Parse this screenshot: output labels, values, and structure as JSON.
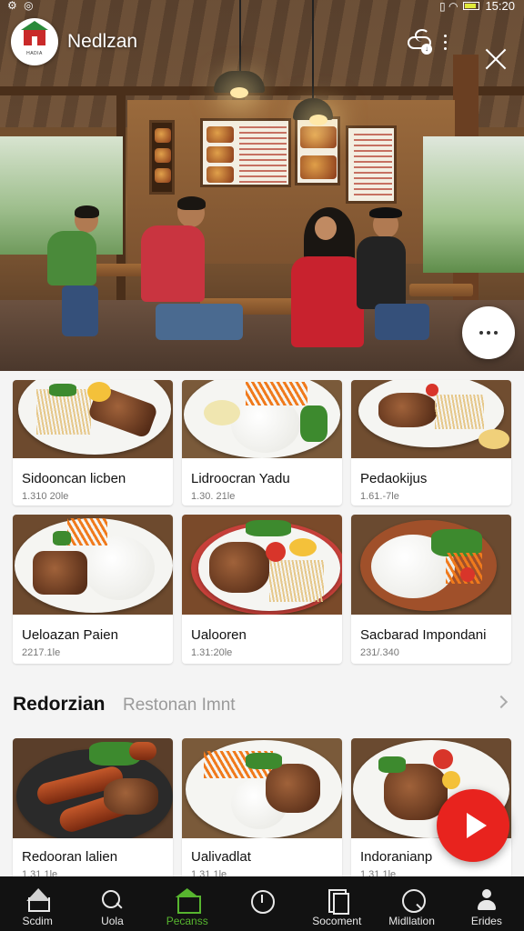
{
  "status_bar": {
    "left_glyphs": "⚙ ◎",
    "right_glyphs": "▯ ◠",
    "time": "15:20"
  },
  "header": {
    "app_title": "Nedlzan",
    "logo_text": "HADIA",
    "cloud_badge": "↓"
  },
  "featured": {
    "items": [
      {
        "name": "Sidooncan licben",
        "price": "1.310 20le"
      },
      {
        "name": "Lidroocran Yadu",
        "price": "1.30. 21le"
      },
      {
        "name": "Pedaokijus",
        "price": "1.61.-7le"
      },
      {
        "name": "Ueloazan Paien",
        "price": "2217.1le"
      },
      {
        "name": "Ualooren",
        "price": "1.31:20le"
      },
      {
        "name": "Sacbarad Impondani",
        "price": "231/.340"
      }
    ]
  },
  "section": {
    "title": "Redorzian",
    "subtitle": "Restonan Imnt",
    "items": [
      {
        "name": "Redooran lalien",
        "price": "1.31 1le"
      },
      {
        "name": "Ualivadlat",
        "price": "1.31 1le"
      },
      {
        "name": "Indoranianp",
        "price": "1.31 1le"
      }
    ]
  },
  "nav": {
    "items": [
      {
        "label": "Scdim",
        "icon": "home-icon"
      },
      {
        "label": "Uola",
        "icon": "search-icon"
      },
      {
        "label": "Pecanss",
        "icon": "shop-icon"
      },
      {
        "label": "",
        "icon": "timer-icon"
      },
      {
        "label": "Socoment",
        "icon": "document-icon"
      },
      {
        "label": "Midllation",
        "icon": "chat-icon"
      },
      {
        "label": "Erides",
        "icon": "profile-icon"
      }
    ],
    "active_index": 2
  },
  "colors": {
    "accent_green": "#57b52f",
    "play_red": "#e8231e",
    "nav_bg": "#121212"
  }
}
